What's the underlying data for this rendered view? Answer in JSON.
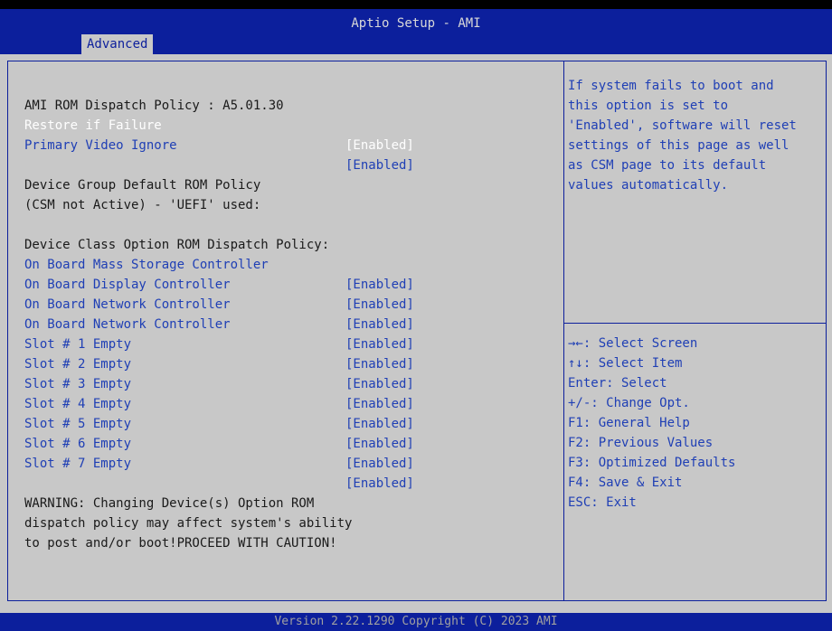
{
  "header": {
    "title": "Aptio Setup - AMI",
    "active_tab": "Advanced"
  },
  "main": {
    "policy_line": "AMI ROM Dispatch Policy : A5.01.30",
    "restore_label": "Restore if Failure",
    "restore_value": "[Enabled]",
    "primary_video_label": "Primary Video Ignore",
    "primary_video_value": "[Enabled]",
    "device_group_line1": "Device Group Default ROM Policy",
    "device_group_line2": "(CSM not Active) - 'UEFI' used:",
    "device_class_heading": "Device Class Option ROM Dispatch Policy:",
    "items": [
      {
        "label": "On Board Mass Storage Controller",
        "value": "[Enabled]"
      },
      {
        "label": "On Board Display Controller",
        "value": "[Enabled]"
      },
      {
        "label": "On Board Network Controller",
        "value": "[Enabled]"
      },
      {
        "label": "On Board Network Controller",
        "value": "[Enabled]"
      },
      {
        "label": "Slot # 1 Empty",
        "value": "[Enabled]"
      },
      {
        "label": "Slot # 2 Empty",
        "value": "[Enabled]"
      },
      {
        "label": "Slot # 3 Empty",
        "value": "[Enabled]"
      },
      {
        "label": "Slot # 4 Empty",
        "value": "[Enabled]"
      },
      {
        "label": "Slot # 5 Empty",
        "value": "[Enabled]"
      },
      {
        "label": "Slot # 6 Empty",
        "value": "[Enabled]"
      },
      {
        "label": "Slot # 7 Empty",
        "value": "[Enabled]"
      }
    ],
    "warning_line1": "WARNING: Changing Device(s) Option ROM",
    "warning_line2": "dispatch policy may affect system's ability",
    "warning_line3": "to post and/or boot!PROCEED WITH CAUTION!"
  },
  "help": {
    "lines": [
      "If system fails to boot and",
      "this option is set to",
      "'Enabled', software will reset",
      "settings of this page as well",
      "as CSM page to its default",
      "values automatically."
    ]
  },
  "keys": [
    "→←: Select Screen",
    "↑↓: Select Item",
    "Enter: Select",
    "+/-: Change Opt.",
    "F1: General Help",
    "F2: Previous Values",
    "F3: Optimized Defaults",
    "F4: Save & Exit",
    "ESC: Exit"
  ],
  "footer": {
    "text": "Version 2.22.1290 Copyright (C) 2023 AMI"
  },
  "colors": {
    "header_bg": "#0c1f9c",
    "body_bg": "#c8c8c8",
    "item_text": "#1f3fb5",
    "static_text": "#1a1a1a",
    "selected_text": "#ffffff"
  }
}
